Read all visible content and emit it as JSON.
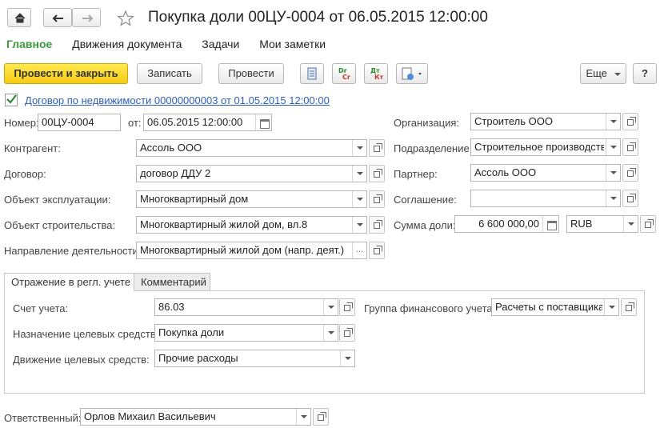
{
  "window": {
    "title": "Покупка доли 00ЦУ-0004 от 06.05.2015 12:00:00"
  },
  "nav_tabs": [
    {
      "label": "Главное",
      "active": true
    },
    {
      "label": "Движения документа",
      "active": false
    },
    {
      "label": "Задачи",
      "active": false
    },
    {
      "label": "Мои заметки",
      "active": false
    }
  ],
  "toolbar": {
    "post_close_label": "Провести и закрыть",
    "save_label": "Записать",
    "post_label": "Провести",
    "dt_kt_label": "Dr Cr",
    "dt_kt_ru_label": "Дт Кт",
    "more_label": "Еще",
    "help_label": "?"
  },
  "based_on": {
    "checked": true,
    "link_text": "Договор по недвижимости 00000000003 от 01.05.2015 12:00:00"
  },
  "header": {
    "number_label": "Номер:",
    "number_value": "00ЦУ-0004",
    "date_label": "от:",
    "date_value": "06.05.2015 12:00:00",
    "counterparty_label": "Контрагент:",
    "counterparty_value": "Ассоль ООО",
    "contract_label": "Договор:",
    "contract_value": "договор ДДУ 2",
    "operation_object_label": "Объект эксплуатации:",
    "operation_object_value": "Многоквартирный дом",
    "construction_object_label": "Объект строительства:",
    "construction_object_value": "Многоквартирный жилой дом, вл.8",
    "activity_label": "Направление деятельности:",
    "activity_value": "Многоквартирный жилой дом (напр. деят.)",
    "organization_label": "Организация:",
    "organization_value": "Строитель ООО",
    "department_label": "Подразделение:",
    "department_value": "Строительное производство",
    "partner_label": "Партнер:",
    "partner_value": "Ассоль ООО",
    "agreement_label": "Соглашение:",
    "agreement_value": "",
    "amount_label": "Сумма доли:",
    "amount_value": "6 600 000,00",
    "currency_value": "RUB"
  },
  "tabs": [
    {
      "label": "Отражение в регл. учете",
      "active": true
    },
    {
      "label": "Комментарий",
      "active": false
    }
  ],
  "accounting": {
    "account_label": "Счет учета:",
    "account_value": "86.03",
    "fin_group_label": "Группа финансового учета:",
    "fin_group_value": "Расчеты с поставщиками",
    "purpose_label": "Назначение целевых средств:",
    "purpose_value": "Покупка доли",
    "movement_label": "Движение целевых средств:",
    "movement_value": "Прочие расходы"
  },
  "footer": {
    "responsible_label": "Ответственный:",
    "responsible_value": "Орлов Михаил Васильевич"
  }
}
